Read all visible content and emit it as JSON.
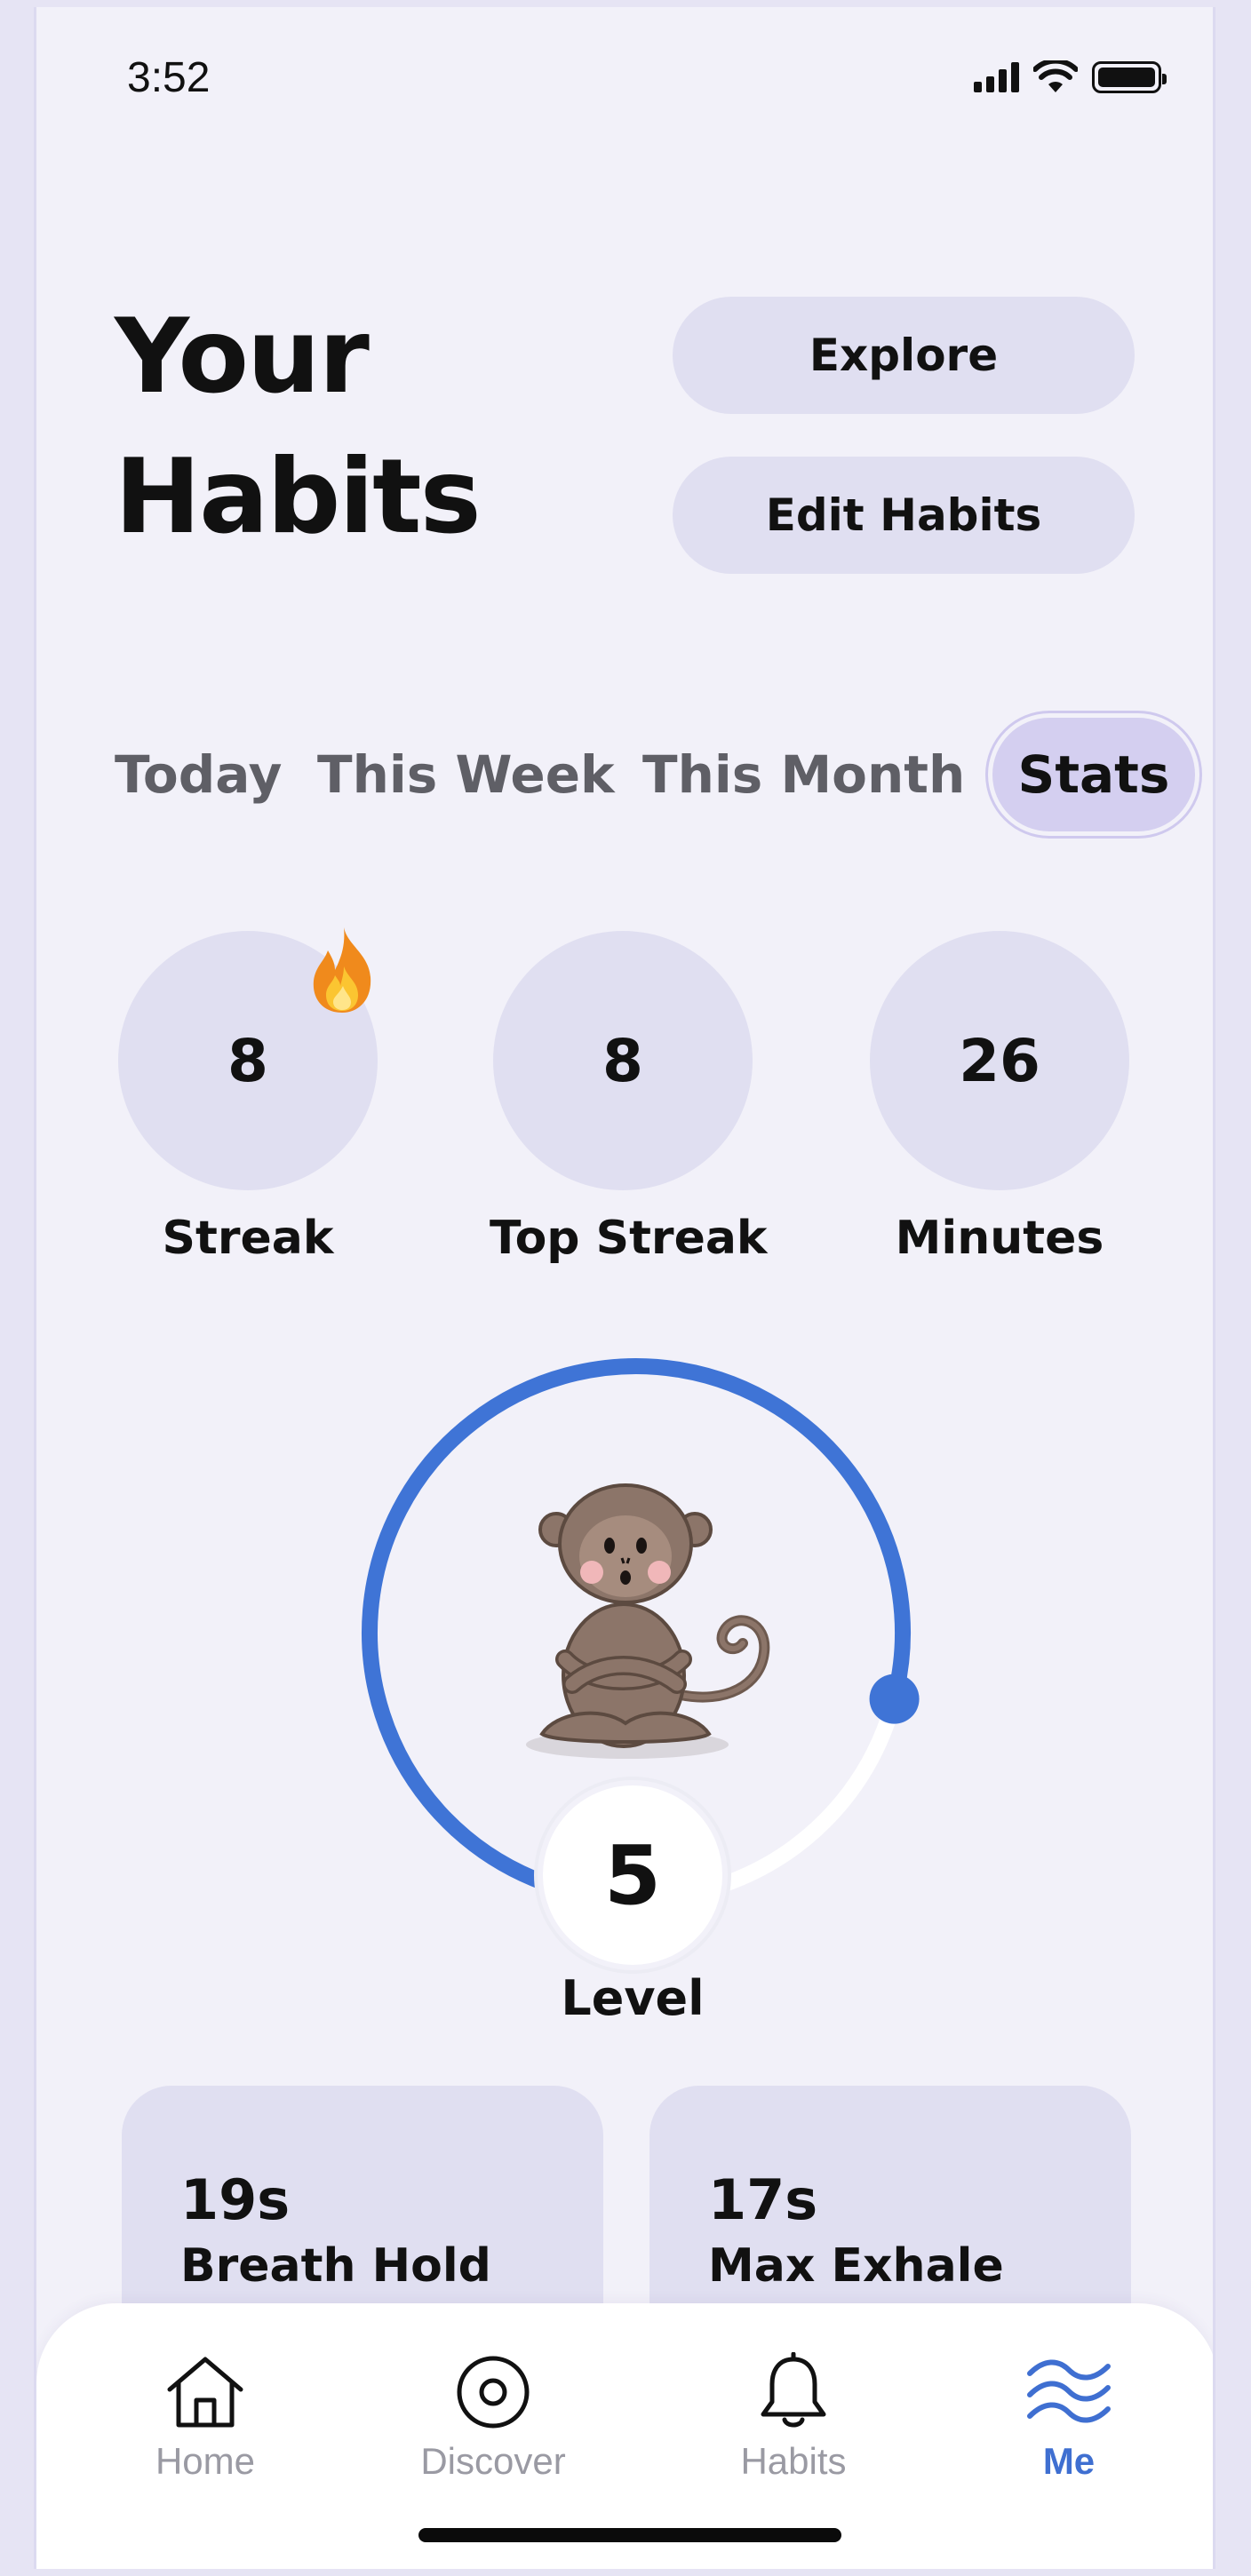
{
  "status_bar": {
    "time": "3:52",
    "signal_icon": "cellular-signal-icon",
    "wifi_icon": "wifi-icon",
    "battery_icon": "battery-icon"
  },
  "header": {
    "title_line1": "Your",
    "title_line2": "Habits",
    "explore_label": "Explore",
    "edit_label": "Edit Habits"
  },
  "tabs": [
    {
      "label": "Today",
      "active": false
    },
    {
      "label": "This Week",
      "active": false
    },
    {
      "label": "This Month",
      "active": false
    },
    {
      "label": "Stats",
      "active": true
    }
  ],
  "stats": {
    "streak": {
      "value": "8",
      "label": "Streak",
      "icon": "flame-icon"
    },
    "top_streak": {
      "value": "8",
      "label": "Top Streak"
    },
    "minutes": {
      "value": "26",
      "label": "Minutes"
    }
  },
  "level": {
    "value": "5",
    "label": "Level",
    "progress_fraction": 0.79,
    "mascot_icon": "meditating-monkey-icon",
    "ring_color": "#3f74d6"
  },
  "cards": [
    {
      "value": "19s",
      "label": "Breath Hold"
    },
    {
      "value": "17s",
      "label": "Max Exhale"
    }
  ],
  "nav": {
    "items": [
      {
        "label": "Home",
        "icon": "home-icon",
        "active": false
      },
      {
        "label": "Discover",
        "icon": "discover-icon",
        "active": false
      },
      {
        "label": "Habits",
        "icon": "bell-icon",
        "active": false
      },
      {
        "label": "Me",
        "icon": "waves-icon",
        "active": true
      }
    ],
    "active_color": "#3f6fd1"
  }
}
